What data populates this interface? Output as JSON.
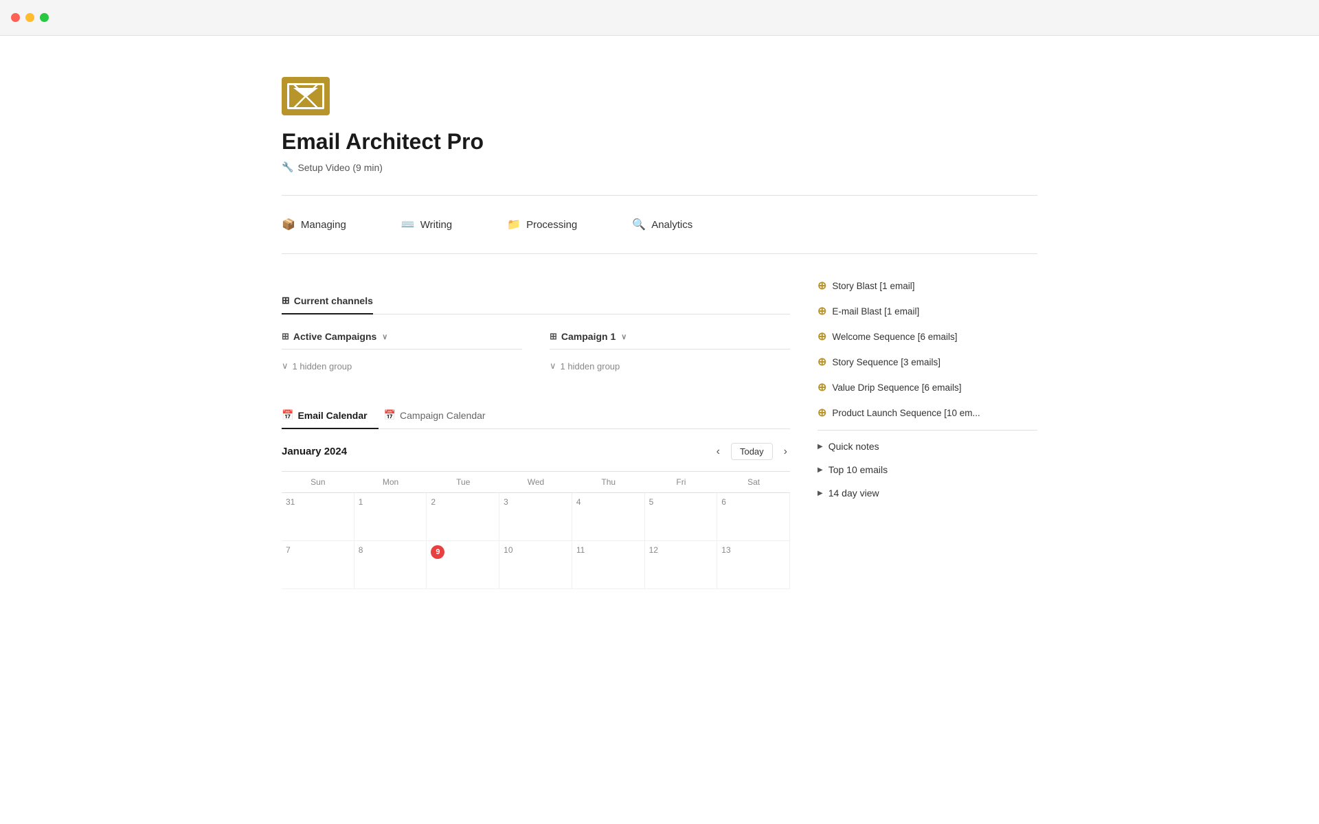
{
  "titlebar": {
    "buttons": [
      "close",
      "minimize",
      "maximize"
    ]
  },
  "header": {
    "title": "Email Architect Pro",
    "setup_link": "Setup Video (9 min)"
  },
  "nav": {
    "items": [
      {
        "id": "managing",
        "label": "Managing",
        "icon": "📦"
      },
      {
        "id": "writing",
        "label": "Writing",
        "icon": "⌨️"
      },
      {
        "id": "processing",
        "label": "Processing",
        "icon": "📁"
      },
      {
        "id": "analytics",
        "label": "Analytics",
        "icon": "🔍"
      }
    ]
  },
  "section_tabs": [
    {
      "id": "current-channels",
      "label": "Current channels",
      "active": true
    }
  ],
  "db_views": [
    {
      "id": "active-campaigns",
      "label": "Active Campaigns",
      "hidden_groups": 1
    },
    {
      "id": "campaign-1",
      "label": "Campaign 1",
      "hidden_groups": 1
    }
  ],
  "right_panel": {
    "sequences": [
      {
        "label": "Story Blast [1 email]"
      },
      {
        "label": "E-mail Blast [1 email]"
      },
      {
        "label": "Welcome Sequence [6 emails]"
      },
      {
        "label": "Story Sequence [3 emails]"
      },
      {
        "label": "Value Drip Sequence [6 emails]"
      },
      {
        "label": "Product Launch Sequence [10 em..."
      }
    ],
    "collapsibles": [
      {
        "label": "Quick notes"
      },
      {
        "label": "Top 10 emails"
      },
      {
        "label": "14 day view"
      }
    ]
  },
  "calendar": {
    "tabs": [
      {
        "label": "Email Calendar",
        "active": true
      },
      {
        "label": "Campaign Calendar",
        "active": false
      }
    ],
    "month": "January 2024",
    "today_label": "Today",
    "day_names": [
      "Sun",
      "Mon",
      "Tue",
      "Wed",
      "Thu",
      "Fri",
      "Sat"
    ],
    "today_date": "9"
  }
}
